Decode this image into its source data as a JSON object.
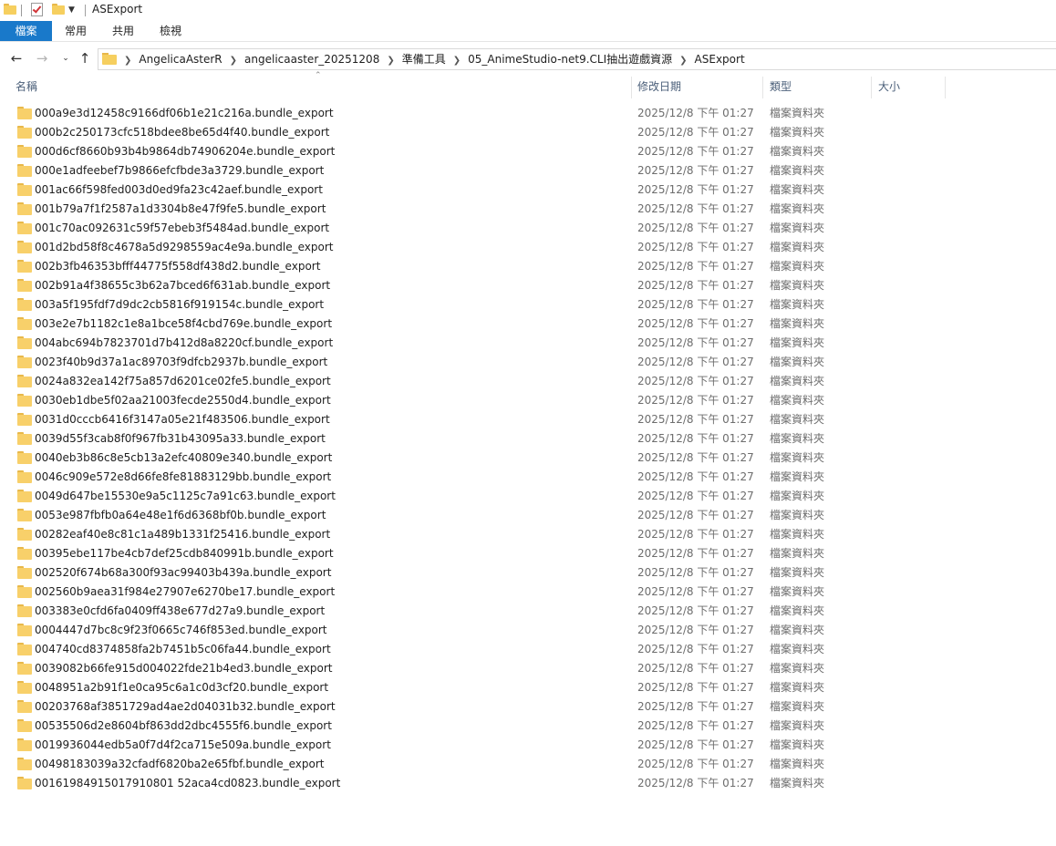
{
  "window": {
    "title": "ASExport"
  },
  "ribbon": {
    "tabs": [
      "檔案",
      "常用",
      "共用",
      "檢視"
    ]
  },
  "nav": {
    "back_icon": "arrow-left-icon",
    "forward_icon": "arrow-right-icon",
    "recent_icon": "chevron-down-icon",
    "up_icon": "arrow-up-icon"
  },
  "address": {
    "crumbs": [
      "AngelicaAsterR",
      "angelicaaster_20251208",
      "準備工具",
      "05_AnimeStudio-net9.CLI抽出遊戲資源",
      "ASExport"
    ]
  },
  "columns": {
    "name": "名稱",
    "date": "修改日期",
    "type": "類型",
    "size": "大小"
  },
  "files": [
    {
      "name": "000a9e3d12458c9166df06b1e21c216a.bundle_export",
      "date": "2025/12/8 下午 01:27",
      "type": "檔案資料夾"
    },
    {
      "name": "000b2c250173cfc518bdee8be65d4f40.bundle_export",
      "date": "2025/12/8 下午 01:27",
      "type": "檔案資料夾"
    },
    {
      "name": "000d6cf8660b93b4b9864db74906204e.bundle_export",
      "date": "2025/12/8 下午 01:27",
      "type": "檔案資料夾"
    },
    {
      "name": "000e1adfeebef7b9866efcfbde3a3729.bundle_export",
      "date": "2025/12/8 下午 01:27",
      "type": "檔案資料夾"
    },
    {
      "name": "001ac66f598fed003d0ed9fa23c42aef.bundle_export",
      "date": "2025/12/8 下午 01:27",
      "type": "檔案資料夾"
    },
    {
      "name": "001b79a7f1f2587a1d3304b8e47f9fe5.bundle_export",
      "date": "2025/12/8 下午 01:27",
      "type": "檔案資料夾"
    },
    {
      "name": "001c70ac092631c59f57ebeb3f5484ad.bundle_export",
      "date": "2025/12/8 下午 01:27",
      "type": "檔案資料夾"
    },
    {
      "name": "001d2bd58f8c4678a5d9298559ac4e9a.bundle_export",
      "date": "2025/12/8 下午 01:27",
      "type": "檔案資料夾"
    },
    {
      "name": "002b3fb46353bfff44775f558df438d2.bundle_export",
      "date": "2025/12/8 下午 01:27",
      "type": "檔案資料夾"
    },
    {
      "name": "002b91a4f38655c3b62a7bced6f631ab.bundle_export",
      "date": "2025/12/8 下午 01:27",
      "type": "檔案資料夾"
    },
    {
      "name": "003a5f195fdf7d9dc2cb5816f919154c.bundle_export",
      "date": "2025/12/8 下午 01:27",
      "type": "檔案資料夾"
    },
    {
      "name": "003e2e7b1182c1e8a1bce58f4cbd769e.bundle_export",
      "date": "2025/12/8 下午 01:27",
      "type": "檔案資料夾"
    },
    {
      "name": "004abc694b7823701d7b412d8a8220cf.bundle_export",
      "date": "2025/12/8 下午 01:27",
      "type": "檔案資料夾"
    },
    {
      "name": "0023f40b9d37a1ac89703f9dfcb2937b.bundle_export",
      "date": "2025/12/8 下午 01:27",
      "type": "檔案資料夾"
    },
    {
      "name": "0024a832ea142f75a857d6201ce02fe5.bundle_export",
      "date": "2025/12/8 下午 01:27",
      "type": "檔案資料夾"
    },
    {
      "name": "0030eb1dbe5f02aa21003fecde2550d4.bundle_export",
      "date": "2025/12/8 下午 01:27",
      "type": "檔案資料夾"
    },
    {
      "name": "0031d0cccb6416f3147a05e21f483506.bundle_export",
      "date": "2025/12/8 下午 01:27",
      "type": "檔案資料夾"
    },
    {
      "name": "0039d55f3cab8f0f967fb31b43095a33.bundle_export",
      "date": "2025/12/8 下午 01:27",
      "type": "檔案資料夾"
    },
    {
      "name": "0040eb3b86c8e5cb13a2efc40809e340.bundle_export",
      "date": "2025/12/8 下午 01:27",
      "type": "檔案資料夾"
    },
    {
      "name": "0046c909e572e8d66fe8fe81883129bb.bundle_export",
      "date": "2025/12/8 下午 01:27",
      "type": "檔案資料夾"
    },
    {
      "name": "0049d647be15530e9a5c1125c7a91c63.bundle_export",
      "date": "2025/12/8 下午 01:27",
      "type": "檔案資料夾"
    },
    {
      "name": "0053e987fbfb0a64e48e1f6d6368bf0b.bundle_export",
      "date": "2025/12/8 下午 01:27",
      "type": "檔案資料夾"
    },
    {
      "name": "00282eaf40e8c81c1a489b1331f25416.bundle_export",
      "date": "2025/12/8 下午 01:27",
      "type": "檔案資料夾"
    },
    {
      "name": "00395ebe117be4cb7def25cdb840991b.bundle_export",
      "date": "2025/12/8 下午 01:27",
      "type": "檔案資料夾"
    },
    {
      "name": "002520f674b68a300f93ac99403b439a.bundle_export",
      "date": "2025/12/8 下午 01:27",
      "type": "檔案資料夾"
    },
    {
      "name": "002560b9aea31f984e27907e6270be17.bundle_export",
      "date": "2025/12/8 下午 01:27",
      "type": "檔案資料夾"
    },
    {
      "name": "003383e0cfd6fa0409ff438e677d27a9.bundle_export",
      "date": "2025/12/8 下午 01:27",
      "type": "檔案資料夾"
    },
    {
      "name": "0004447d7bc8c9f23f0665c746f853ed.bundle_export",
      "date": "2025/12/8 下午 01:27",
      "type": "檔案資料夾"
    },
    {
      "name": "004740cd8374858fa2b7451b5c06fa44.bundle_export",
      "date": "2025/12/8 下午 01:27",
      "type": "檔案資料夾"
    },
    {
      "name": "0039082b66fe915d004022fde21b4ed3.bundle_export",
      "date": "2025/12/8 下午 01:27",
      "type": "檔案資料夾"
    },
    {
      "name": "0048951a2b91f1e0ca95c6a1c0d3cf20.bundle_export",
      "date": "2025/12/8 下午 01:27",
      "type": "檔案資料夾"
    },
    {
      "name": "00203768af3851729ad4ae2d04031b32.bundle_export",
      "date": "2025/12/8 下午 01:27",
      "type": "檔案資料夾"
    },
    {
      "name": "00535506d2e8604bf863dd2dbc4555f6.bundle_export",
      "date": "2025/12/8 下午 01:27",
      "type": "檔案資料夾"
    },
    {
      "name": "0019936044edb5a0f7d4f2ca715e509a.bundle_export",
      "date": "2025/12/8 下午 01:27",
      "type": "檔案資料夾"
    },
    {
      "name": "00498183039a32cfadf6820ba2e65fbf.bundle_export",
      "date": "2025/12/8 下午 01:27",
      "type": "檔案資料夾"
    },
    {
      "name": "00161984915017910801 52aca4cd0823.bundle_export",
      "date": "2025/12/8 下午 01:27",
      "type": "檔案資料夾"
    }
  ]
}
